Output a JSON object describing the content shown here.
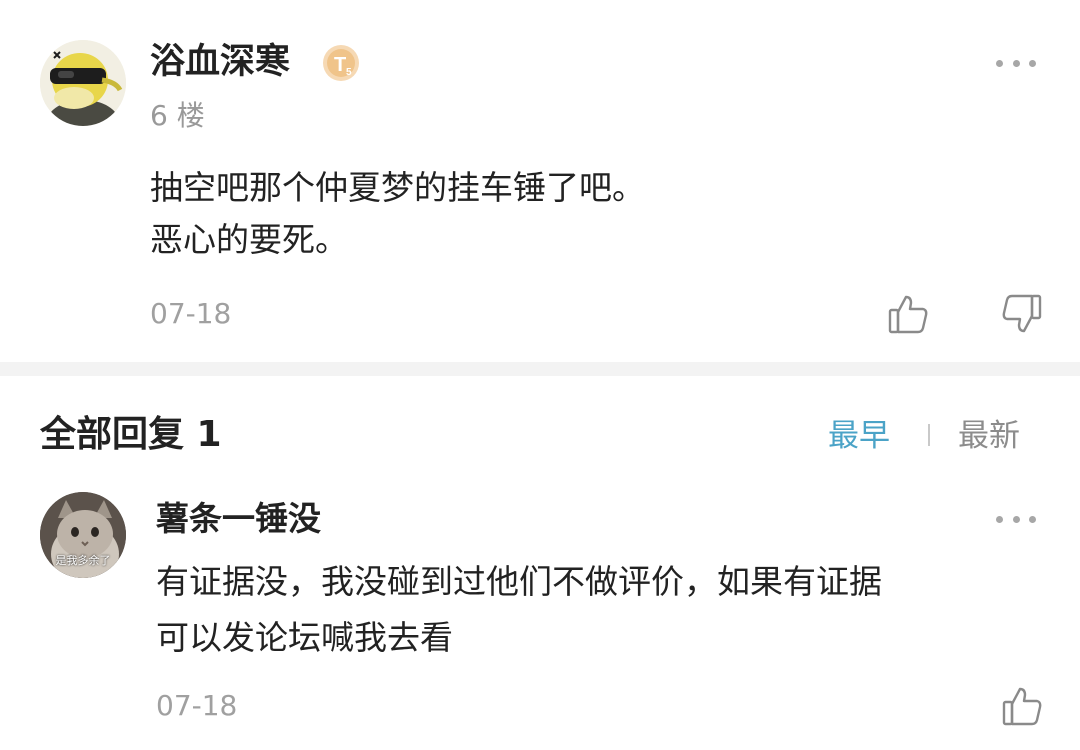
{
  "post": {
    "username": "浴血深寒",
    "badge_icon": "level-badge-icon",
    "floor": "6 楼",
    "body_lines": [
      "抽空吧那个仲夏梦的挂车锤了吧。",
      "恶心的要死。"
    ],
    "date": "07-18"
  },
  "replies": {
    "title": "全部回复 1",
    "sort_options": [
      "最早",
      "最新"
    ],
    "active_sort": "最早",
    "active_color": "#4ba3c7",
    "items": [
      {
        "username": "薯条一锤没",
        "avatar_caption": "是我多余了",
        "body_lines": [
          "有证据没，我没碰到过他们不做评价，如果有证据",
          "可以发论坛喊我去看"
        ],
        "date": "07-18"
      }
    ]
  }
}
